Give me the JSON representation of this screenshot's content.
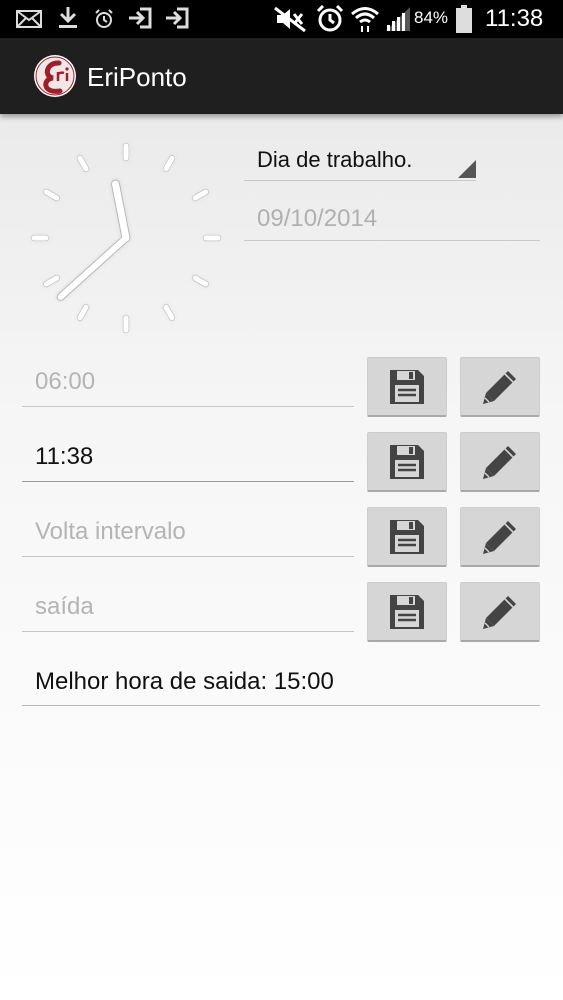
{
  "status_bar": {
    "battery_percent": "84%",
    "time": "11:38",
    "icons": [
      "mail-icon",
      "download-icon",
      "alarm-icon",
      "signin-icon",
      "signin-icon",
      "mute-icon",
      "alarm-clock-icon",
      "wifi-icon",
      "signal-icon",
      "battery-icon"
    ]
  },
  "action_bar": {
    "title": "EriPonto",
    "logo_text": "Eri"
  },
  "day_type": {
    "selected": "Dia de trabalho."
  },
  "date": {
    "value": "09/10/2014"
  },
  "clock": {
    "time": "11:38"
  },
  "entries": [
    {
      "placeholder": "06:00",
      "value": "",
      "filled": false
    },
    {
      "placeholder": "",
      "value": "11:38",
      "filled": true
    },
    {
      "placeholder": "Volta intervalo",
      "value": "",
      "filled": false
    },
    {
      "placeholder": "saída",
      "value": "",
      "filled": false
    }
  ],
  "buttons": {
    "save_icon": "save-icon",
    "edit_icon": "pencil-icon"
  },
  "best_exit": {
    "text": "Melhor hora de saida: 15:00"
  },
  "colors": {
    "action_bar": "#1f1f1f",
    "logo_red": "#9c1f2a"
  }
}
